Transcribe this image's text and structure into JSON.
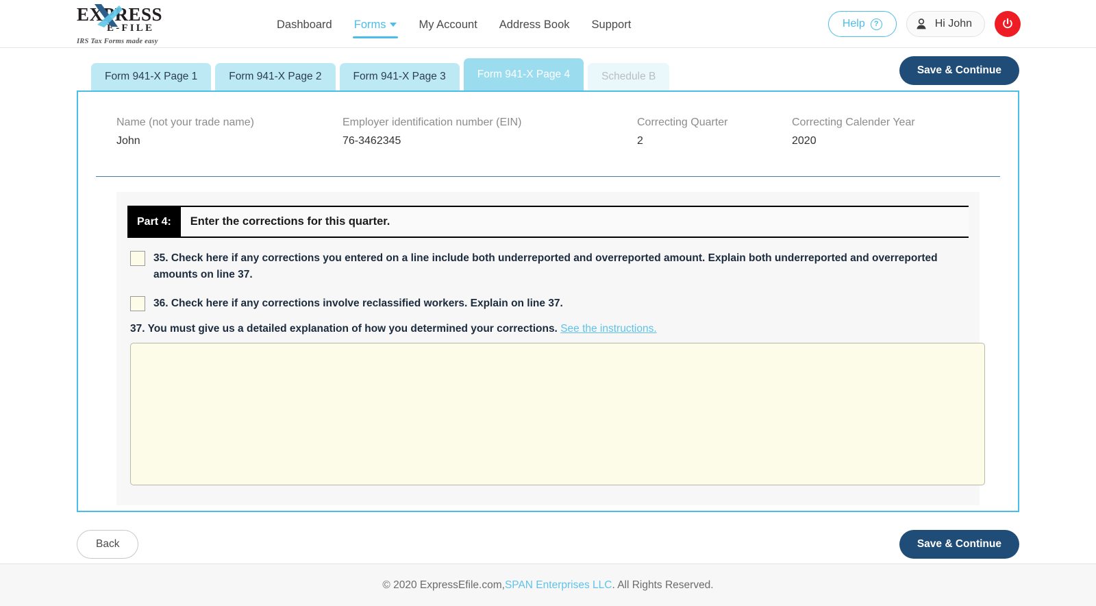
{
  "brand": {
    "logo_word": "EXPRESS",
    "logo_sub": "E-FILE",
    "logo_tagline": "IRS Tax Forms made easy",
    "accent_cyan": "#4cbde8",
    "accent_navy": "#204c78",
    "accent_red": "#ee1c24"
  },
  "nav": {
    "items": [
      {
        "label": "Dashboard",
        "active": false,
        "has_caret": false
      },
      {
        "label": "Forms",
        "active": true,
        "has_caret": true
      },
      {
        "label": "My Account",
        "active": false,
        "has_caret": false
      },
      {
        "label": "Address Book",
        "active": false,
        "has_caret": false
      },
      {
        "label": "Support",
        "active": false,
        "has_caret": false
      }
    ]
  },
  "header_right": {
    "help_label": "Help",
    "help_icon": "question-circle-icon",
    "user_greeting": "Hi John",
    "user_icon": "person-icon",
    "power_icon": "power-icon"
  },
  "tabs": [
    {
      "label": "Form 941-X Page 1",
      "state": "normal"
    },
    {
      "label": "Form 941-X Page 2",
      "state": "normal"
    },
    {
      "label": "Form 941-X Page 3",
      "state": "normal"
    },
    {
      "label": "Form 941-X Page 4",
      "state": "active"
    },
    {
      "label": "Schedule B",
      "state": "disabled"
    }
  ],
  "toolbar": {
    "save_top_label": "Save & Continue"
  },
  "form_meta": [
    {
      "label": "Name (not your trade name)",
      "value": "John"
    },
    {
      "label": "Employer identification number (EIN)",
      "value": "76-3462345"
    },
    {
      "label": "Correcting Quarter",
      "value": "2"
    },
    {
      "label": "Correcting Calender Year",
      "value": "2020"
    }
  ],
  "part": {
    "badge": "Part 4:",
    "title": "Enter the corrections for this quarter."
  },
  "lines": {
    "line35": {
      "text": "35. Check here if any corrections you entered on a line include both underreported and overreported amount. Explain both underreported and overreported amounts on line 37.",
      "checked": false
    },
    "line36": {
      "text": "36. Check here if any corrections involve reclassified workers. Explain on line 37.",
      "checked": false
    },
    "line37": {
      "text": "37. You must give us a detailed explanation of how you determined your corrections.",
      "link_text": "See the instructions.",
      "explanation_value": "",
      "explanation_placeholder": ""
    }
  },
  "actions": {
    "back_label": "Back",
    "save_bottom_label": "Save & Continue"
  },
  "footer": {
    "text_before": "© 2020 ExpressEfile.com, ",
    "link": "SPAN Enterprises LLC",
    "text_after": ". All Rights Reserved."
  }
}
